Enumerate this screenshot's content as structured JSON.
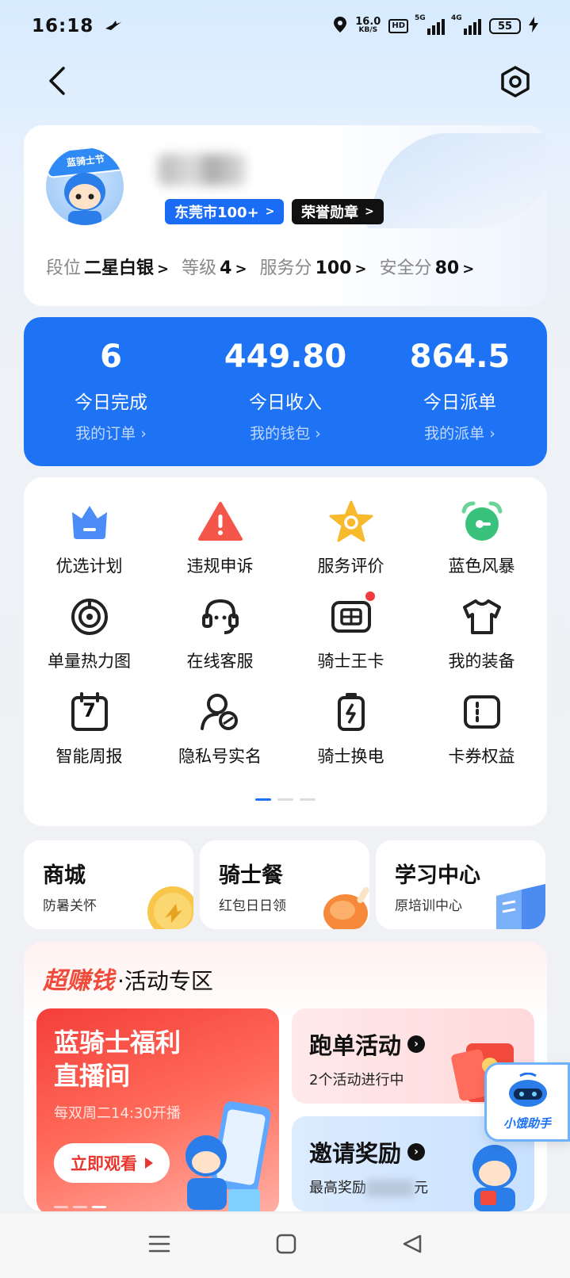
{
  "status_bar": {
    "time": "16:18",
    "net_speed_value": "16.0",
    "net_speed_unit": "KB/S",
    "hd_label": "HD",
    "sim1_label": "5G",
    "sim2_label": "4G",
    "battery": "55"
  },
  "profile": {
    "city_badge": "东莞市100+",
    "honor_badge": "荣誉勋章",
    "avatar_cap_text": "蓝骑士节",
    "stats": [
      {
        "label": "段位",
        "value": "二星白银"
      },
      {
        "label": "等级",
        "value": "4"
      },
      {
        "label": "服务分",
        "value": "100"
      },
      {
        "label": "安全分",
        "value": "80"
      }
    ]
  },
  "today": [
    {
      "value": "6",
      "label": "今日完成",
      "link": "我的订单"
    },
    {
      "value": "449.80",
      "label": "今日收入",
      "link": "我的钱包"
    },
    {
      "value": "864.5",
      "label": "今日派单",
      "link": "我的派单"
    }
  ],
  "tools": [
    {
      "label": "优选计划",
      "icon": "crown-icon"
    },
    {
      "label": "违规申诉",
      "icon": "warning-icon"
    },
    {
      "label": "服务评价",
      "icon": "star-icon"
    },
    {
      "label": "蓝色风暴",
      "icon": "alarm-icon"
    },
    {
      "label": "单量热力图",
      "icon": "target-icon"
    },
    {
      "label": "在线客服",
      "icon": "headset-icon"
    },
    {
      "label": "骑士王卡",
      "icon": "sim-card-icon"
    },
    {
      "label": "我的装备",
      "icon": "tshirt-icon"
    },
    {
      "label": "智能周报",
      "icon": "calendar-icon"
    },
    {
      "label": "隐私号实名",
      "icon": "user-privacy-icon"
    },
    {
      "label": "骑士换电",
      "icon": "battery-swap-icon"
    },
    {
      "label": "卡券权益",
      "icon": "coupon-icon"
    }
  ],
  "calendar_day": "7",
  "mini_cards": [
    {
      "title": "商城",
      "sub": "防暑关怀"
    },
    {
      "title": "骑士餐",
      "sub": "红包日日领"
    },
    {
      "title": "学习中心",
      "sub": "原培训中心"
    }
  ],
  "promo": {
    "head_hot": "超赚钱",
    "head_rest": "·活动专区",
    "live_title": "蓝骑士福利\n直播间",
    "live_sub": "每双周二14:30开播",
    "live_button": "立即观看",
    "run_title": "跑单活动",
    "run_sub": "2个活动进行中",
    "invite_title": "邀请奖励",
    "invite_sub_prefix": "最高奖励",
    "invite_sub_suffix": "元"
  },
  "assistant_label": "小饿助手",
  "colors": {
    "brand_blue": "#1e73f5",
    "badge_black": "#111111",
    "promo_red": "#f04a3b"
  }
}
